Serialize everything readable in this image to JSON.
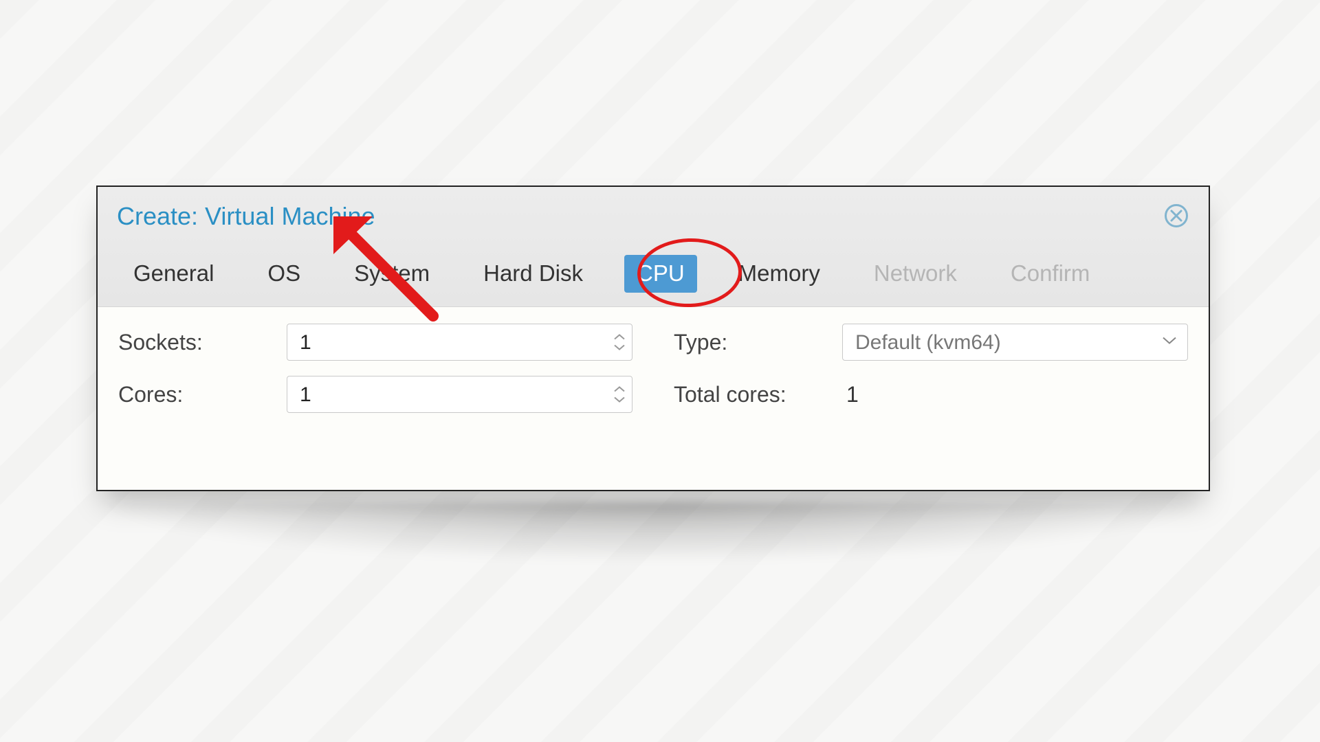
{
  "dialog": {
    "title": "Create: Virtual Machine"
  },
  "tabs": {
    "items": [
      {
        "label": "General",
        "state": "normal"
      },
      {
        "label": "OS",
        "state": "normal"
      },
      {
        "label": "System",
        "state": "normal"
      },
      {
        "label": "Hard Disk",
        "state": "normal"
      },
      {
        "label": "CPU",
        "state": "active"
      },
      {
        "label": "Memory",
        "state": "normal"
      },
      {
        "label": "Network",
        "state": "disabled"
      },
      {
        "label": "Confirm",
        "state": "disabled"
      }
    ]
  },
  "cpu": {
    "sockets_label": "Sockets:",
    "sockets_value": "1",
    "cores_label": "Cores:",
    "cores_value": "1",
    "type_label": "Type:",
    "type_value": "Default (kvm64)",
    "totalcores_label": "Total cores:",
    "totalcores_value": "1"
  },
  "annotations": {
    "highlight_tab_index": 4,
    "arrow_target": "cores-input"
  },
  "colors": {
    "accent": "#4d9ad3",
    "title": "#2a8fc4",
    "annotation": "#e21b1b"
  }
}
